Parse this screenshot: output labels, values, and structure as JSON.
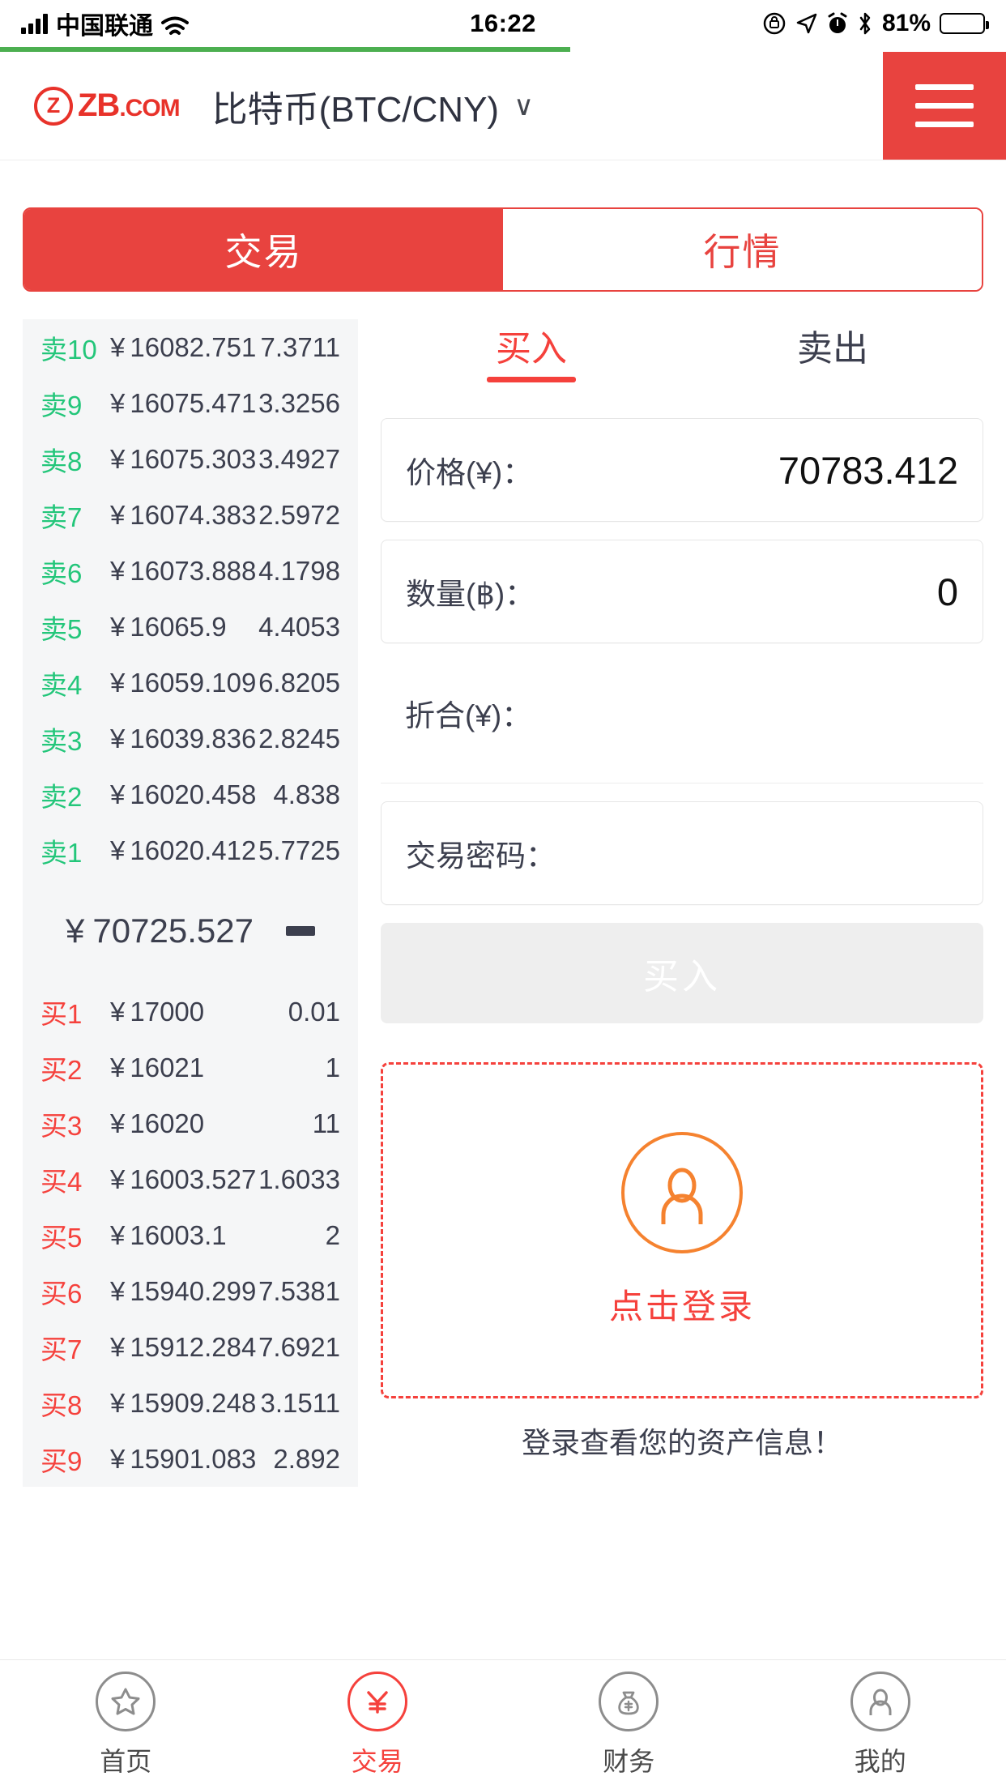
{
  "status_bar": {
    "carrier": "中国联通",
    "time": "16:22",
    "battery_percent": "81%",
    "icons": [
      "signal-icon",
      "wifi-icon",
      "rotation-lock-icon",
      "location-icon",
      "alarm-icon",
      "bluetooth-icon",
      "battery-icon"
    ]
  },
  "header": {
    "logo_mark": "Ⓩ",
    "logo_text": "ZB",
    "logo_suffix": ".COM",
    "pair_title": "比特币(BTC/CNY)",
    "chevron": "∨",
    "menu_icon": "hamburger-icon"
  },
  "tabs": [
    {
      "label": "交易",
      "active": true
    },
    {
      "label": "行情",
      "active": false
    }
  ],
  "orderbook": {
    "currency_symbol": "¥",
    "sell_orders": [
      {
        "tag": "卖10",
        "price": "16082.751",
        "amount": "7.3711"
      },
      {
        "tag": "卖9",
        "price": "16075.471",
        "amount": "3.3256"
      },
      {
        "tag": "卖8",
        "price": "16075.303",
        "amount": "3.4927"
      },
      {
        "tag": "卖7",
        "price": "16074.383",
        "amount": "2.5972"
      },
      {
        "tag": "卖6",
        "price": "16073.888",
        "amount": "4.1798"
      },
      {
        "tag": "卖5",
        "price": "16065.9",
        "amount": "4.4053"
      },
      {
        "tag": "卖4",
        "price": "16059.109",
        "amount": "6.8205"
      },
      {
        "tag": "卖3",
        "price": "16039.836",
        "amount": "2.8245"
      },
      {
        "tag": "卖2",
        "price": "16020.458",
        "amount": "4.838"
      },
      {
        "tag": "卖1",
        "price": "16020.412",
        "amount": "5.7725"
      }
    ],
    "last_price": "70725.527",
    "trend": "flat",
    "buy_orders": [
      {
        "tag": "买1",
        "price": "17000",
        "amount": "0.01"
      },
      {
        "tag": "买2",
        "price": "16021",
        "amount": "1"
      },
      {
        "tag": "买3",
        "price": "16020",
        "amount": "11"
      },
      {
        "tag": "买4",
        "price": "16003.527",
        "amount": "1.6033"
      },
      {
        "tag": "买5",
        "price": "16003.1",
        "amount": "2"
      },
      {
        "tag": "买6",
        "price": "15940.299",
        "amount": "7.5381"
      },
      {
        "tag": "买7",
        "price": "15912.284",
        "amount": "7.6921"
      },
      {
        "tag": "买8",
        "price": "15909.248",
        "amount": "3.1511"
      },
      {
        "tag": "买9",
        "price": "15901.083",
        "amount": "2.892"
      }
    ]
  },
  "trade_form": {
    "side_tabs": [
      {
        "label": "买入",
        "active": true
      },
      {
        "label": "卖出",
        "active": false
      }
    ],
    "price_label": "价格(¥)：",
    "price_value": "70783.412",
    "amount_label": "数量(฿)：",
    "amount_value": "0",
    "total_label": "折合(¥)：",
    "total_value": "",
    "password_label": "交易密码：",
    "password_value": "",
    "submit_label": "买入",
    "login_text": "点击登录",
    "login_sub": "登录查看您的资产信息！",
    "avatar_icon": "person-icon"
  },
  "bottom_nav": [
    {
      "label": "首页",
      "icon": "star-icon",
      "active": false
    },
    {
      "label": "交易",
      "icon": "exchange-icon",
      "active": true
    },
    {
      "label": "财务",
      "icon": "moneybag-icon",
      "active": false
    },
    {
      "label": "我的",
      "icon": "person-icon",
      "active": false
    }
  ],
  "colors": {
    "brand_red": "#e8433f",
    "sell_green": "#23c67a",
    "buy_red": "#f5413c",
    "accent_orange": "#f5822f",
    "panel_bg": "#f5f6f7"
  }
}
